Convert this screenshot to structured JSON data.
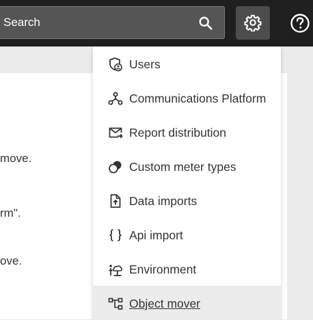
{
  "header": {
    "search_placeholder": "Search",
    "search_icon": "search-icon",
    "settings_icon": "gear-icon",
    "help_icon": "help-circle-icon"
  },
  "page": {
    "lines": [
      "move.",
      "rm\".",
      "ove."
    ]
  },
  "settings_menu": {
    "items": [
      {
        "label": "Users",
        "icon": "user-shield-icon"
      },
      {
        "label": "Communications Platform",
        "icon": "network-nodes-icon"
      },
      {
        "label": "Report distribution",
        "icon": "mail-send-icon"
      },
      {
        "label": "Custom meter types",
        "icon": "overlapping-circles-icon"
      },
      {
        "label": "Data imports",
        "icon": "file-upload-icon"
      },
      {
        "label": "Api import",
        "icon": "curly-braces-icon"
      },
      {
        "label": "Environment",
        "icon": "environment-icon"
      },
      {
        "label": "Object mover",
        "icon": "object-mover-icon",
        "active": true
      }
    ]
  },
  "colors": {
    "topbar": "#1f1f1f",
    "search_bg": "#555555",
    "active_item_bg": "#ececec"
  }
}
